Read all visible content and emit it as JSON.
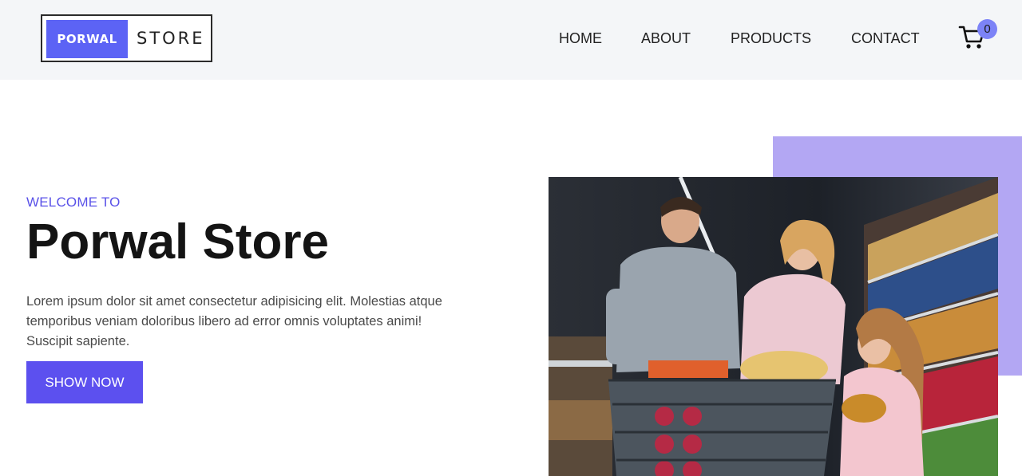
{
  "brand": {
    "logo_left": "PORWAL",
    "logo_right": "STORE"
  },
  "nav": {
    "home": "HOME",
    "about": "ABOUT",
    "products": "PRODUCTS",
    "contact": "CONTACT"
  },
  "cart": {
    "icon": "cart-icon",
    "count": "0"
  },
  "hero": {
    "eyebrow": "WELCOME TO",
    "title": "Porwal Store",
    "description": "Lorem ipsum dolor sit amet consectetur adipisicing elit. Molestias atque temporibus veniam doloribus libero ad error omnis voluptates animi! Suscipit sapiente.",
    "cta": "SHOW NOW"
  },
  "colors": {
    "header_bg": "#f4f6f8",
    "accent": "#5c50ef",
    "accent_light": "#b3a7f3",
    "badge": "#7c83f7"
  }
}
